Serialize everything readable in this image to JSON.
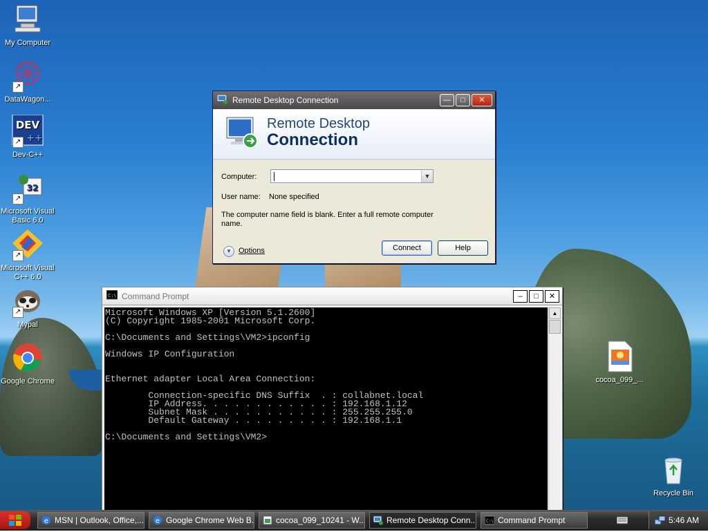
{
  "desktop": {
    "icons": [
      {
        "label": "My Computer"
      },
      {
        "label": "DataWagon..."
      },
      {
        "label": "Dev-C++"
      },
      {
        "label": "Microsoft Visual Basic 6.0"
      },
      {
        "label": "Microsoft Visual C++ 6.0"
      },
      {
        "label": "Mypal"
      },
      {
        "label": "Google Chrome"
      },
      {
        "label": "cocoa_099_..."
      },
      {
        "label": "Recycle Bin"
      }
    ]
  },
  "rdc": {
    "title": "Remote Desktop Connection",
    "header_line1": "Remote Desktop",
    "header_line2": "Connection",
    "computer_label": "Computer:",
    "computer_value": "",
    "username_label": "User name:",
    "username_value": "None specified",
    "message": "The computer name field is blank. Enter a full remote computer name.",
    "options_label": "Options",
    "connect_label": "Connect",
    "help_label": "Help"
  },
  "cmd": {
    "title": "Command Prompt",
    "output": "Microsoft Windows XP [Version 5.1.2600]\n(C) Copyright 1985-2001 Microsoft Corp.\n\nC:\\Documents and Settings\\VM2>ipconfig\n\nWindows IP Configuration\n\n\nEthernet adapter Local Area Connection:\n\n        Connection-specific DNS Suffix  . : collabnet.local\n        IP Address. . . . . . . . . . . . : 192.168.1.12\n        Subnet Mask . . . . . . . . . . . : 255.255.255.0\n        Default Gateway . . . . . . . . . : 192.168.1.1\n\nC:\\Documents and Settings\\VM2>"
  },
  "taskbar": {
    "tasks": [
      {
        "label": "MSN | Outlook, Office,..."
      },
      {
        "label": "Google Chrome Web B..."
      },
      {
        "label": "cocoa_099_10241 - W..."
      },
      {
        "label": "Remote Desktop Conn..."
      },
      {
        "label": "Command Prompt"
      }
    ],
    "clock": "5:46 AM"
  },
  "colors": {
    "titlebar_active": "#4a4a4a",
    "accent": "#0d2e66"
  }
}
